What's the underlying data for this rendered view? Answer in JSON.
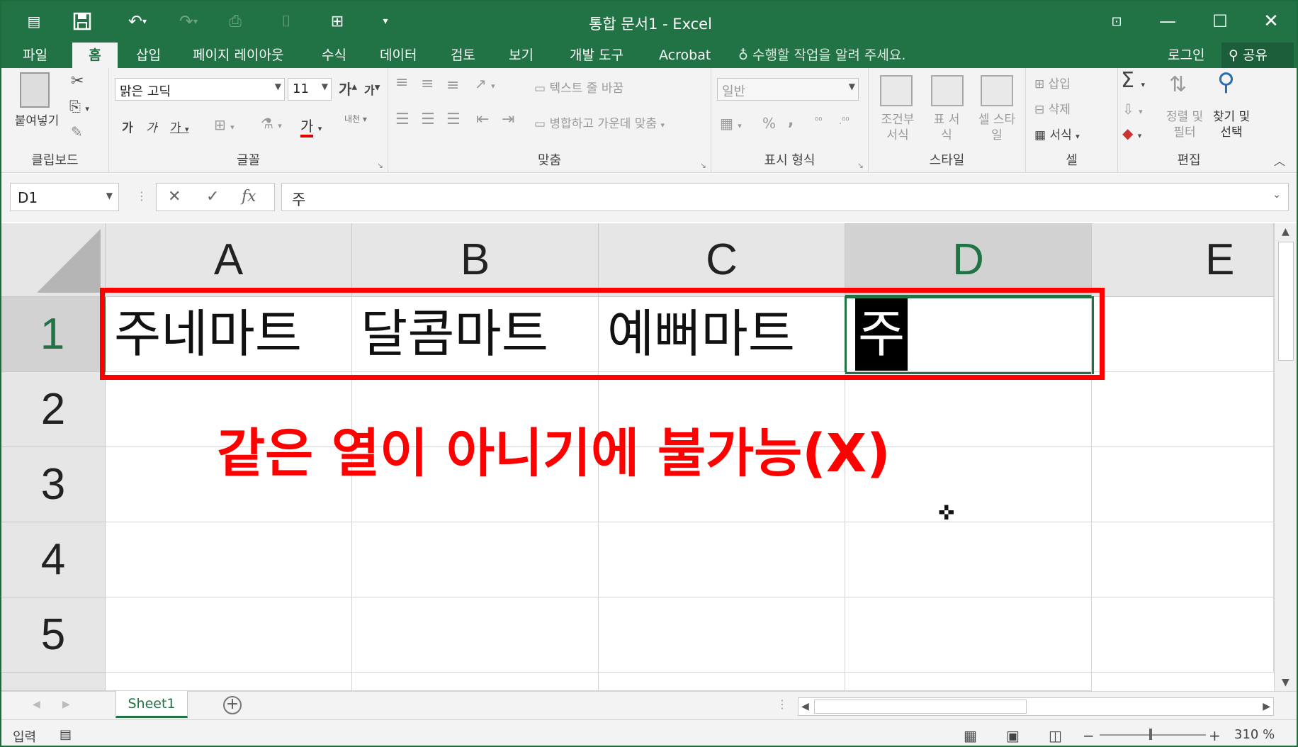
{
  "app": {
    "title": "통합 문서1 - Excel"
  },
  "tabs": [
    "파일",
    "홈",
    "삽입",
    "페이지 레이아웃",
    "수식",
    "데이터",
    "검토",
    "보기",
    "개발 도구",
    "Acrobat"
  ],
  "tell_me": "수행할 작업을 알려 주세요.",
  "login": "로그인",
  "share": "공유",
  "ribbon": {
    "clipboard": {
      "paste": "붙여넣기",
      "label": "클립보드"
    },
    "font": {
      "name": "맑은 고딕",
      "size": "11",
      "label": "글꼴",
      "grow": "가",
      "shrink": "가",
      "bold": "가",
      "italic": "가",
      "underline": "가",
      "color": "가",
      "phonetic": "내천"
    },
    "align": {
      "wrap": "텍스트 줄 바꿈",
      "merge": "병합하고 가운데 맞춤",
      "label": "맞춤"
    },
    "number": {
      "format": "일반",
      "label": "표시 형식",
      "percent": "%",
      "comma": ","
    },
    "styles": {
      "cond": "조건부 서식",
      "table": "표 서식",
      "cell": "셀 스타일",
      "label": "스타일"
    },
    "cells": {
      "insert": "삽입",
      "delete": "삭제",
      "format": "서식",
      "label": "셀"
    },
    "editing": {
      "sort": "정렬 및 필터",
      "find": "찾기 및 선택",
      "label": "편집"
    }
  },
  "formula_bar": {
    "name_box": "D1",
    "content": "주"
  },
  "grid": {
    "columns": [
      "A",
      "B",
      "C",
      "D",
      "E"
    ],
    "rows": [
      "1",
      "2",
      "3",
      "4",
      "5"
    ],
    "selected_column": "D",
    "selected_row": "1",
    "cells": {
      "A1": "주네마트",
      "B1": "달콤마트",
      "C1": "예뻐마트",
      "D1": "주"
    }
  },
  "annotation": "같은 열이 아니기에 불가능(X)",
  "sheets": [
    "Sheet1"
  ],
  "status": {
    "mode": "입력",
    "zoom": "310 %"
  },
  "colors": {
    "excel_green": "#217346",
    "annotation_red": "#ff0000"
  }
}
